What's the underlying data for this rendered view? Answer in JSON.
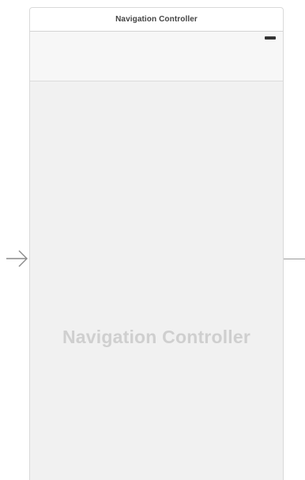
{
  "scene": {
    "title": "Navigation Controller",
    "placeholder": "Navigation Controller"
  },
  "icons": {
    "entry_arrow": "arrow-right-icon",
    "battery": "battery-icon"
  }
}
